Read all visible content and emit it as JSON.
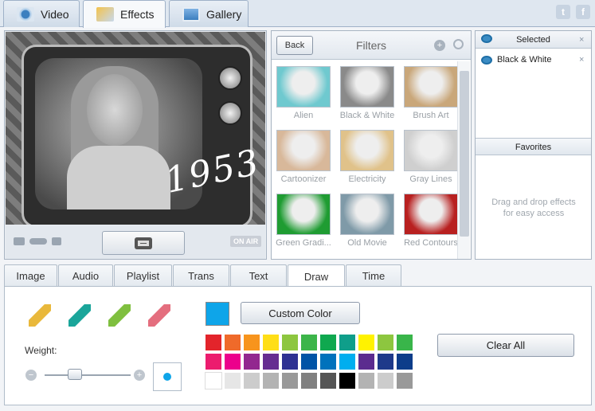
{
  "top_tabs": [
    {
      "label": "Video",
      "icon": "webcam-icon"
    },
    {
      "label": "Effects",
      "icon": "effects-icon"
    },
    {
      "label": "Gallery",
      "icon": "gallery-icon"
    }
  ],
  "social": {
    "twitter": "t",
    "facebook": "f"
  },
  "preview": {
    "overlay_text": "1953",
    "on_air": "ON AIR"
  },
  "filters": {
    "back_label": "Back",
    "title": "Filters",
    "items": [
      {
        "label": "Alien",
        "tint": "#6fc9cf"
      },
      {
        "label": "Black & White",
        "tint": "#8a8a8a"
      },
      {
        "label": "Brush Art",
        "tint": "#c9a77a"
      },
      {
        "label": "Cartoonizer",
        "tint": "#d8b89a"
      },
      {
        "label": "Electricity",
        "tint": "#e0c28a"
      },
      {
        "label": "Gray Lines",
        "tint": "#cfcfcf"
      },
      {
        "label": "Green Gradi...",
        "tint": "#1f9c32"
      },
      {
        "label": "Old Movie",
        "tint": "#7f9aa8"
      },
      {
        "label": "Red Contours",
        "tint": "#b82020"
      }
    ]
  },
  "selected": {
    "title": "Selected",
    "items": [
      {
        "label": "Black & White"
      }
    ]
  },
  "favorites": {
    "title": "Favorites",
    "hint": "Drag and drop effects for easy access"
  },
  "bottom_tabs": [
    "Image",
    "Audio",
    "Playlist",
    "Trans",
    "Text",
    "Draw",
    "Time"
  ],
  "draw": {
    "weight_label": "Weight:",
    "weight_level": 0.32,
    "tools": [
      "pencil-icon",
      "brush-icon",
      "paint-bucket-icon",
      "eraser-icon"
    ],
    "current_color": "#0ea5e9",
    "custom_color_label": "Custom Color",
    "clear_all_label": "Clear All",
    "palette": [
      [
        "#e3242b",
        "#ef6a2a",
        "#f7941d",
        "#ffde17",
        "#8dc63f",
        "#3cb54a",
        "#0fa84f",
        "#0f9e8a",
        "#fff200",
        "#8dc63f",
        "#39b54a"
      ],
      [
        "#ec1c6e",
        "#ec008c",
        "#92278f",
        "#662d91",
        "#2e3192",
        "#0054a6",
        "#0072bc",
        "#00aeef",
        "#5b2c8f",
        "#1e3a8a",
        "#0d3d8a"
      ],
      [
        "#ffffff",
        "#e6e6e6",
        "#cccccc",
        "#b3b3b3",
        "#999999",
        "#808080",
        "#555555",
        "#000000",
        "#b3b3b3",
        "#cccccc",
        "#999999"
      ]
    ]
  }
}
